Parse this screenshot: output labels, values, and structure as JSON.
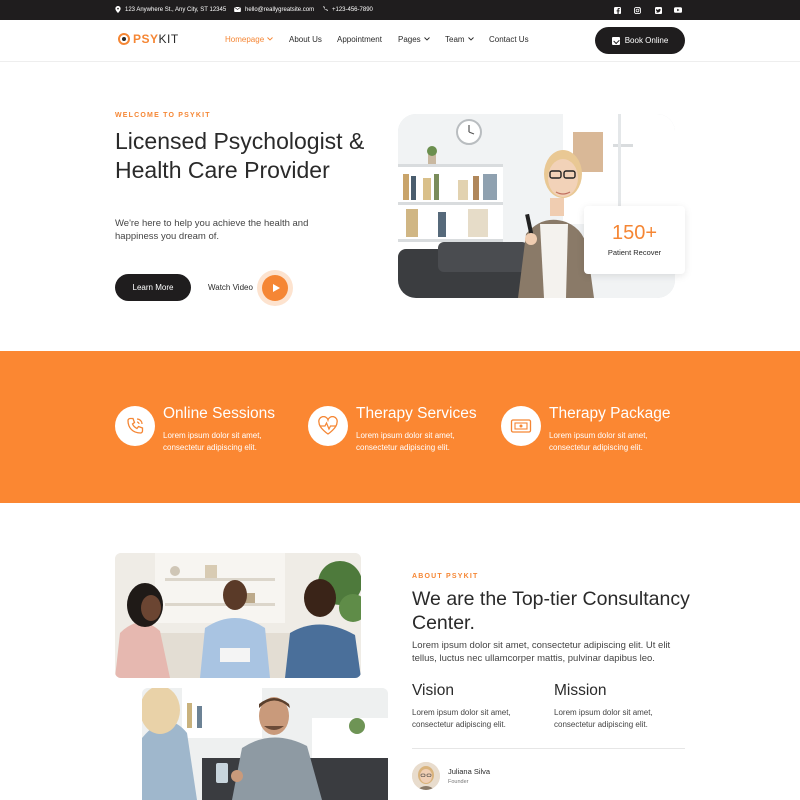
{
  "topbar": {
    "address": "123 Anywhere St., Any City, ST 12345",
    "email": "hello@reallygreatsite.com",
    "phone": "+123-456-7890",
    "socials": [
      "facebook-icon",
      "instagram-icon",
      "twitter-icon",
      "youtube-icon"
    ]
  },
  "nav": {
    "logo_psy": "PSY",
    "logo_kit": "KIT",
    "links": [
      {
        "label": "Homepage",
        "dropdown": true,
        "active": true
      },
      {
        "label": "About Us",
        "dropdown": false
      },
      {
        "label": "Appointment",
        "dropdown": false
      },
      {
        "label": "Pages",
        "dropdown": true
      },
      {
        "label": "Team",
        "dropdown": true
      },
      {
        "label": "Contact Us",
        "dropdown": false
      }
    ],
    "book_label": "Book Online"
  },
  "hero": {
    "eyebrow": "WELCOME TO PSYKIT",
    "title": "Licensed Psychologist & Health Care Provider",
    "subtitle": "We're here to help you achieve the health and happiness you dream of.",
    "learn_label": "Learn More",
    "watch_label": "Watch Video",
    "stat_number": "150+",
    "stat_label": "Patient Recover"
  },
  "features": [
    {
      "icon": "phone-icon",
      "title": "Online Sessions",
      "desc": "Lorem ipsum dolor sit amet, consectetur adipiscing elit."
    },
    {
      "icon": "heart-pulse-icon",
      "title": "Therapy Services",
      "desc": "Lorem ipsum dolor sit amet, consectetur adipiscing elit."
    },
    {
      "icon": "package-icon",
      "title": "Therapy Package",
      "desc": "Lorem ipsum dolor sit amet, consectetur adipiscing elit."
    }
  ],
  "about": {
    "eyebrow": "ABOUT PSYKIT",
    "title": "We are the Top-tier Consultancy Center.",
    "text": "Lorem ipsum dolor sit amet, consectetur adipiscing elit. Ut elit tellus, luctus nec ullamcorper mattis, pulvinar dapibus leo.",
    "vision_title": "Vision",
    "vision_text": "Lorem ipsum dolor sit amet, consectetur adipiscing elit.",
    "mission_title": "Mission",
    "mission_text": "Lorem ipsum dolor sit amet, consectetur adipiscing elit.",
    "founder_name": "Juliana Silva",
    "founder_role": "Founder"
  },
  "colors": {
    "accent": "#f58634",
    "band": "#fb8732",
    "dark": "#1f1d1e"
  }
}
